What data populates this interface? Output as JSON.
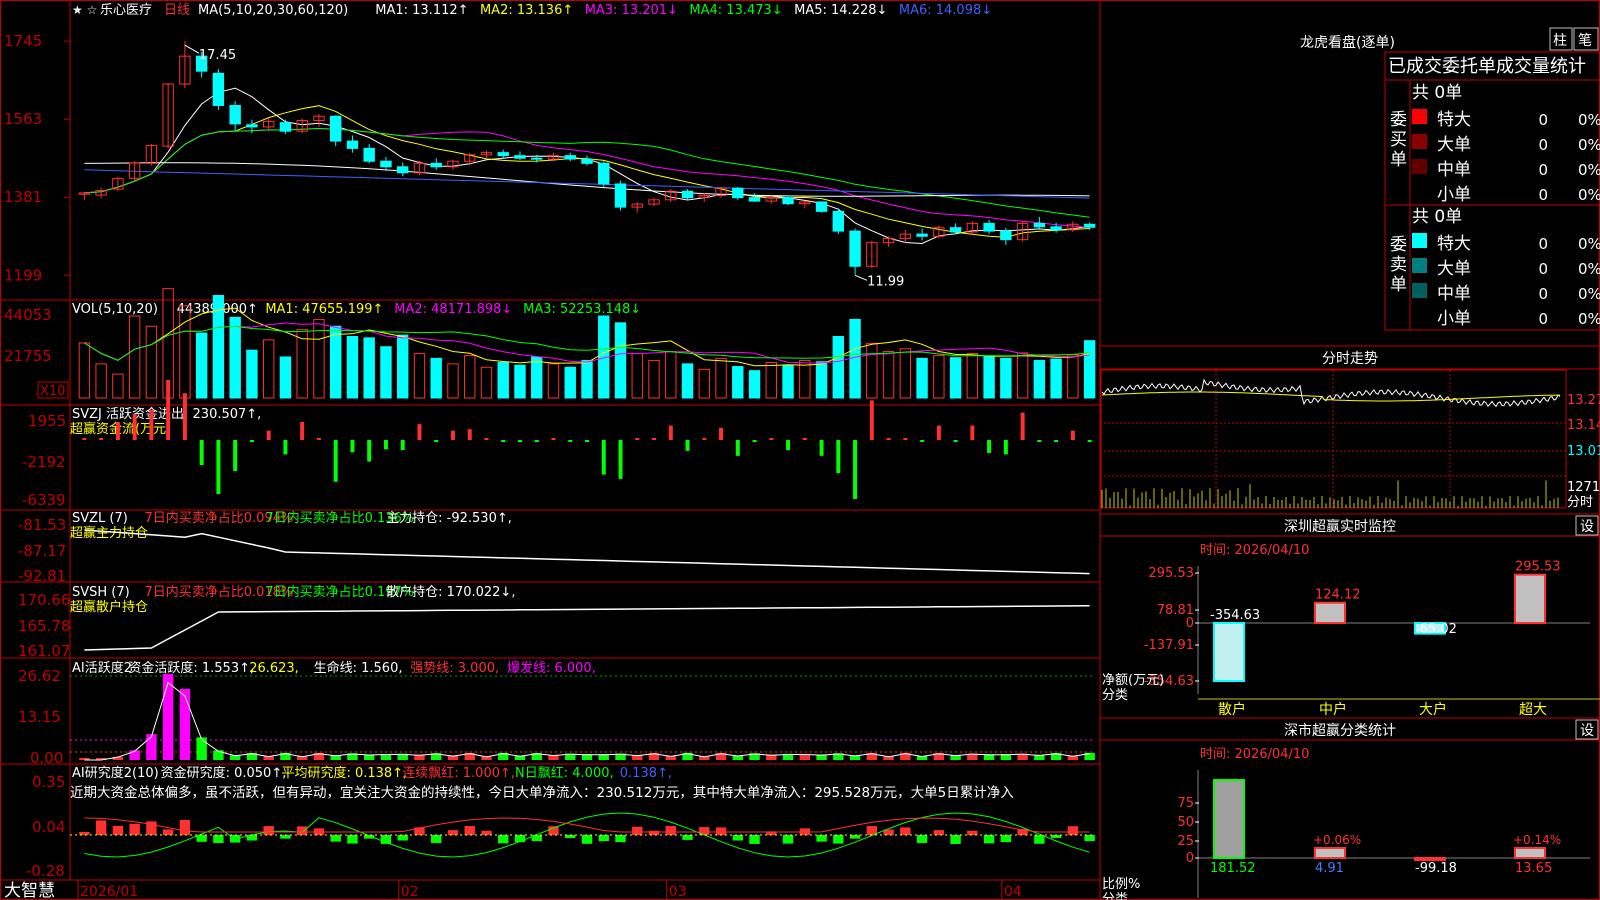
{
  "stock": {
    "name": "乐心医疗",
    "period": "日线",
    "stars": "★ ☆",
    "high_note": "17.45",
    "low_note": "11.99"
  },
  "brand": "大智慧",
  "x_dates": [
    "2026/01",
    "02",
    "03",
    "04"
  ],
  "price_panel": {
    "axis": [
      "1745",
      "1563",
      "1381",
      "1199"
    ],
    "legend": [
      {
        "t": "MA(5,10,20,30,60,120)",
        "c": "#ffffff"
      },
      {
        "t": "MA1: 13.112↑",
        "c": "#ffffff"
      },
      {
        "t": "MA2: 13.136↑",
        "c": "#ffff00"
      },
      {
        "t": "MA3: 13.201↓",
        "c": "#ff00ff"
      },
      {
        "t": "MA4: 13.473↓",
        "c": "#00ff00"
      },
      {
        "t": "MA5: 14.228↓",
        "c": "#ffffff"
      },
      {
        "t": "MA6: 14.098↓",
        "c": "#4060ff"
      }
    ]
  },
  "vol_panel": {
    "axis": [
      "44053",
      "21755"
    ],
    "unit": "X10",
    "legend": [
      {
        "t": "VOL(5,10,20)",
        "c": "#ffffff"
      },
      {
        "t": "44389.000↑",
        "c": "#ffffff"
      },
      {
        "t": "MA1: 47655.199↑",
        "c": "#ffff00"
      },
      {
        "t": "MA2: 48171.898↓",
        "c": "#ff00ff"
      },
      {
        "t": "MA3: 52253.148↓",
        "c": "#00ff00"
      }
    ]
  },
  "svzj_panel": {
    "axis": [
      "1955",
      "-2192",
      "-6339"
    ],
    "legend": [
      {
        "t": "SVZJ  活跃资金进出: 230.507↑,",
        "c": "#ffffff"
      }
    ],
    "sub": "超赢资金流(万元)"
  },
  "svzl_panel": {
    "axis": [
      "-81.53",
      "-87.17",
      "-92.81"
    ],
    "legend": [
      {
        "t": "SVZL (7)",
        "c": "#ffffff"
      },
      {
        "t": "7日内买卖净占比0.094%",
        "c": "#ff3030"
      },
      {
        "t": "7日内买卖净占比0.136%",
        "c": "#00ff00"
      },
      {
        "t": "主力持仓: -92.530↑,",
        "c": "#ffffff"
      }
    ],
    "sub": "超赢主力持仓"
  },
  "svsh_panel": {
    "axis": [
      "170.66",
      "165.78",
      "161.07"
    ],
    "legend": [
      {
        "t": "SVSH (7)",
        "c": "#ffffff"
      },
      {
        "t": "7日内买卖净占比0.018%",
        "c": "#ff3030"
      },
      {
        "t": "7日内买卖净占比0.197%",
        "c": "#00ff00"
      },
      {
        "t": "散户持仓: 170.022↓,",
        "c": "#ffffff"
      }
    ],
    "sub": "超赢散户持仓"
  },
  "ai1_panel": {
    "axis": [
      "26.62",
      "13.15",
      "0.00"
    ],
    "legend": [
      {
        "t": "AI活跃度2",
        "c": "#ffffff"
      },
      {
        "t": "资金活跃度: 1.553↑,",
        "c": "#ffffff"
      },
      {
        "t": "26.623,",
        "c": "#ffff00"
      },
      {
        "t": "生命线: 1.560,",
        "c": "#ffffff"
      },
      {
        "t": "强势线: 3.000,",
        "c": "#ff3030"
      },
      {
        "t": "爆发线: 6.000,",
        "c": "#ff00ff"
      }
    ]
  },
  "ai2_panel": {
    "axis": [
      "0.35",
      "0.04",
      "-0.28"
    ],
    "legend": [
      {
        "t": "AI研究度2(10)",
        "c": "#ffffff"
      },
      {
        "t": "资金研究度: 0.050↑,",
        "c": "#ffffff"
      },
      {
        "t": "平均研究度: 0.138↑,",
        "c": "#ffff00"
      },
      {
        "t": "连续飘红: 1.000↑,",
        "c": "#ff3030"
      },
      {
        "t": "N日飘红: 4.000,",
        "c": "#00ff00"
      },
      {
        "t": "0.138↑,",
        "c": "#4060ff"
      }
    ],
    "comment": "近期大资金总体偏多，虽不活跃，但有异动，宜关注大资金的持续性，今日大单净流入：230.512万元，其中特大单净流入：295.528万元，大单5日累计净入"
  },
  "lhb": {
    "title": "龙虎看盘(逐单)",
    "btn1": "柱",
    "btn2": "笔",
    "header": "已成交委托单成交量统计",
    "buy_label": "委买单",
    "sell_label": "委卖单",
    "buy_total": "共 0单",
    "sell_total": "共 0单",
    "buy_rows": [
      {
        "name": "特大",
        "count": "0",
        "pct": "0%",
        "color": "#ff0000"
      },
      {
        "name": "大单",
        "count": "0",
        "pct": "0%",
        "color": "#8b0000"
      },
      {
        "name": "中单",
        "count": "0",
        "pct": "0%",
        "color": "#600000"
      },
      {
        "name": "小单",
        "count": "0",
        "pct": "0%",
        "color": ""
      }
    ],
    "sell_rows": [
      {
        "name": "特大",
        "count": "0",
        "pct": "0%",
        "color": "#00ffff"
      },
      {
        "name": "大单",
        "count": "0",
        "pct": "0%",
        "color": "#008080"
      },
      {
        "name": "中单",
        "count": "0",
        "pct": "0%",
        "color": "#006060"
      },
      {
        "name": "小单",
        "count": "0",
        "pct": "0%",
        "color": ""
      }
    ]
  },
  "fenshi": {
    "title": "分时走势",
    "axis": [
      "13.27",
      "13.14",
      "13.01",
      "1271"
    ],
    "note": "分时"
  },
  "monitor": {
    "title": "深圳超赢实时监控",
    "btn": "设",
    "time": "时间: 2026/04/10",
    "axis": [
      "295.53",
      "78.81",
      "0",
      "-137.91",
      "-354.63"
    ],
    "cats": [
      "散户",
      "中户",
      "大户",
      "超大"
    ],
    "values": [
      -354.63,
      124.12,
      -65.02,
      295.53
    ],
    "labels": [
      "-354.63",
      "124.12",
      "-65.02",
      "295.53"
    ],
    "ylabel1": "净额(万元)",
    "ylabel2": "分类"
  },
  "classify": {
    "title": "深市超赢分类统计",
    "btn": "设",
    "time": "时间: 2026/04/10",
    "axis": [
      "75",
      "50",
      "25",
      "0"
    ],
    "cats": [
      "散户",
      "中户",
      "大户",
      "超大"
    ],
    "values": [
      181.52,
      4.91,
      -99.18,
      13.65
    ],
    "labels": [
      "181.52",
      "4.91",
      "-99.18",
      "13.65"
    ],
    "top_labels": [
      "",
      "+0.06%",
      "",
      "+0.14%"
    ],
    "ylabel1": "比例%",
    "ylabel2": "分类"
  },
  "chart_data": {
    "type": "candlestick",
    "title": "乐心医疗 日线",
    "xlabel": "",
    "ylabel": "",
    "ylim": [
      11.99,
      17.45
    ],
    "x": [
      "2026/01",
      "02",
      "03",
      "04"
    ],
    "ohlc": [
      [
        13.88,
        13.93,
        13.75,
        13.91
      ],
      [
        13.86,
        14.03,
        13.78,
        13.97
      ],
      [
        14.0,
        14.28,
        13.95,
        14.25
      ],
      [
        14.25,
        14.65,
        14.2,
        14.61
      ],
      [
        14.6,
        15.05,
        14.55,
        15.02
      ],
      [
        15.0,
        16.48,
        14.95,
        16.45
      ],
      [
        16.45,
        17.45,
        16.35,
        17.1
      ],
      [
        17.1,
        17.2,
        16.6,
        16.75
      ],
      [
        16.7,
        16.8,
        15.85,
        15.95
      ],
      [
        15.95,
        16.05,
        15.35,
        15.52
      ],
      [
        15.5,
        15.62,
        15.3,
        15.45
      ],
      [
        15.45,
        15.65,
        15.35,
        15.58
      ],
      [
        15.55,
        15.62,
        15.28,
        15.35
      ],
      [
        15.35,
        15.65,
        15.3,
        15.6
      ],
      [
        15.6,
        15.75,
        15.45,
        15.7
      ],
      [
        15.7,
        15.72,
        15.0,
        15.12
      ],
      [
        15.12,
        15.25,
        14.85,
        14.95
      ],
      [
        14.95,
        15.05,
        14.6,
        14.65
      ],
      [
        14.65,
        14.75,
        14.42,
        14.52
      ],
      [
        14.52,
        14.62,
        14.3,
        14.38
      ],
      [
        14.38,
        14.65,
        14.32,
        14.6
      ],
      [
        14.6,
        14.72,
        14.45,
        14.52
      ],
      [
        14.52,
        14.68,
        14.45,
        14.65
      ],
      [
        14.65,
        14.85,
        14.55,
        14.8
      ],
      [
        14.8,
        14.9,
        14.7,
        14.85
      ],
      [
        14.85,
        14.92,
        14.72,
        14.78
      ],
      [
        14.78,
        14.88,
        14.68,
        14.72
      ],
      [
        14.72,
        14.8,
        14.62,
        14.7
      ],
      [
        14.7,
        14.85,
        14.65,
        14.78
      ],
      [
        14.78,
        14.85,
        14.65,
        14.7
      ],
      [
        14.7,
        14.78,
        14.55,
        14.6
      ],
      [
        14.6,
        14.65,
        14.05,
        14.12
      ],
      [
        14.12,
        14.2,
        13.5,
        13.58
      ],
      [
        13.58,
        13.7,
        13.45,
        13.65
      ],
      [
        13.65,
        13.8,
        13.6,
        13.75
      ],
      [
        13.75,
        14.0,
        13.7,
        13.95
      ],
      [
        13.95,
        14.0,
        13.75,
        13.8
      ],
      [
        13.8,
        13.9,
        13.7,
        13.85
      ],
      [
        13.85,
        14.05,
        13.8,
        14.02
      ],
      [
        14.02,
        14.05,
        13.75,
        13.8
      ],
      [
        13.8,
        13.9,
        13.7,
        13.72
      ],
      [
        13.72,
        13.85,
        13.65,
        13.8
      ],
      [
        13.8,
        13.85,
        13.62,
        13.66
      ],
      [
        13.66,
        13.72,
        13.55,
        13.7
      ],
      [
        13.7,
        13.72,
        13.45,
        13.48
      ],
      [
        13.48,
        13.55,
        12.95,
        13.02
      ],
      [
        13.02,
        13.08,
        12.0,
        12.2
      ],
      [
        12.2,
        12.8,
        12.15,
        12.75
      ],
      [
        12.75,
        12.9,
        12.65,
        12.85
      ],
      [
        12.85,
        13.05,
        12.75,
        12.95
      ],
      [
        12.95,
        13.08,
        12.8,
        12.9
      ],
      [
        12.9,
        13.15,
        12.85,
        13.1
      ],
      [
        13.1,
        13.2,
        12.95,
        13.0
      ],
      [
        13.0,
        13.25,
        12.95,
        13.2
      ],
      [
        13.2,
        13.28,
        12.95,
        13.02
      ],
      [
        13.02,
        13.1,
        12.7,
        12.82
      ],
      [
        12.82,
        13.25,
        12.78,
        13.2
      ],
      [
        13.2,
        13.35,
        13.05,
        13.12
      ],
      [
        13.12,
        13.22,
        12.98,
        13.05
      ],
      [
        13.05,
        13.25,
        13.0,
        13.18
      ],
      [
        13.18,
        13.22,
        13.05,
        13.11
      ]
    ],
    "volume": [
      44053,
      41000,
      39500,
      48000,
      46500,
      52000,
      49500,
      45500,
      51000,
      47800,
      43000,
      44500,
      42000,
      46000,
      47500,
      46500,
      45000,
      44800,
      43500,
      45200,
      42500,
      41800,
      41000,
      42200,
      40500,
      41200,
      40800,
      42000,
      41000,
      40500,
      41500,
      48000,
      47000,
      42500,
      41500,
      42800,
      41000,
      40200,
      41800,
      40600,
      40000,
      41200,
      40800,
      41500,
      41300,
      45000,
      47500,
      44000,
      42800,
      43200,
      41800,
      42200,
      41900,
      42500,
      42100,
      41800,
      42600,
      41500,
      41700,
      42300,
      44389
    ],
    "series": [
      {
        "name": "MA1",
        "values": []
      },
      {
        "name": "MA2",
        "values": []
      },
      {
        "name": "MA3",
        "values": []
      },
      {
        "name": "MA4",
        "values": []
      },
      {
        "name": "MA5",
        "values": []
      },
      {
        "name": "MA6",
        "values": []
      }
    ],
    "grid": false,
    "legend": "top-left"
  }
}
